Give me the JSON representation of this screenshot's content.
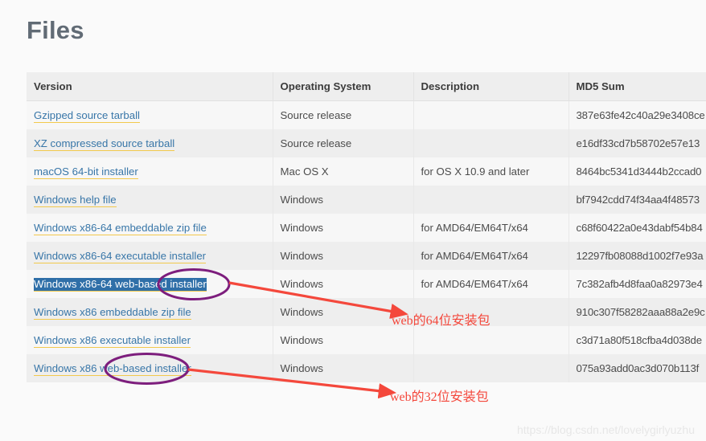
{
  "page": {
    "title": "Files",
    "watermark": "https://blog.csdn.net/lovelygirlyuzhu",
    "background_color": "#fafafa"
  },
  "table": {
    "columns": [
      "Version",
      "Operating System",
      "Description",
      "MD5 Sum"
    ],
    "rows": [
      {
        "version": "Gzipped source tarball",
        "os": "Source release",
        "description": "",
        "md5": "387e63fe42c40a29e3408ce"
      },
      {
        "version": "XZ compressed source tarball",
        "os": "Source release",
        "description": "",
        "md5": "e16df33cd7b58702e57e13"
      },
      {
        "version": "macOS 64-bit installer",
        "os": "Mac OS X",
        "description": "for OS X 10.9 and later",
        "md5": "8464bc5341d3444b2ccad0"
      },
      {
        "version": "Windows help file",
        "os": "Windows",
        "description": "",
        "md5": "bf7942cdd74f34aa4f48573"
      },
      {
        "version": "Windows x86-64 embeddable zip file",
        "os": "Windows",
        "description": "for AMD64/EM64T/x64",
        "md5": "c68f60422a0e43dabf54b84"
      },
      {
        "version": "Windows x86-64 executable installer",
        "os": "Windows",
        "description": "for AMD64/EM64T/x64",
        "md5": "12297fb08088d1002f7e93a"
      },
      {
        "version": "Windows x86-64 web-based installer",
        "os": "Windows",
        "description": "for AMD64/EM64T/x64",
        "md5": "7c382afb4d8faa0a82973e4"
      },
      {
        "version": "Windows x86 embeddable zip file",
        "os": "Windows",
        "description": "",
        "md5": "910c307f58282aaa88a2e9c"
      },
      {
        "version": "Windows x86 executable installer",
        "os": "Windows",
        "description": "",
        "md5": "c3d71a80f518cfba4d038de"
      },
      {
        "version": "Windows x86 web-based installer",
        "os": "Windows",
        "description": "",
        "md5": "075a93add0ac3d070b113f"
      }
    ],
    "selected_row_index": 6
  },
  "annotations": {
    "color": "#f4483c",
    "ellipse_color": "#7d1e7d",
    "labels": [
      {
        "text": "web的 64位安装包",
        "display": "web的64位安装包"
      },
      {
        "text": "web的 32位安装包",
        "display": "web的32位安装包"
      }
    ],
    "label_64": "web的64位安装包",
    "label_32": "web的32位安装包"
  }
}
